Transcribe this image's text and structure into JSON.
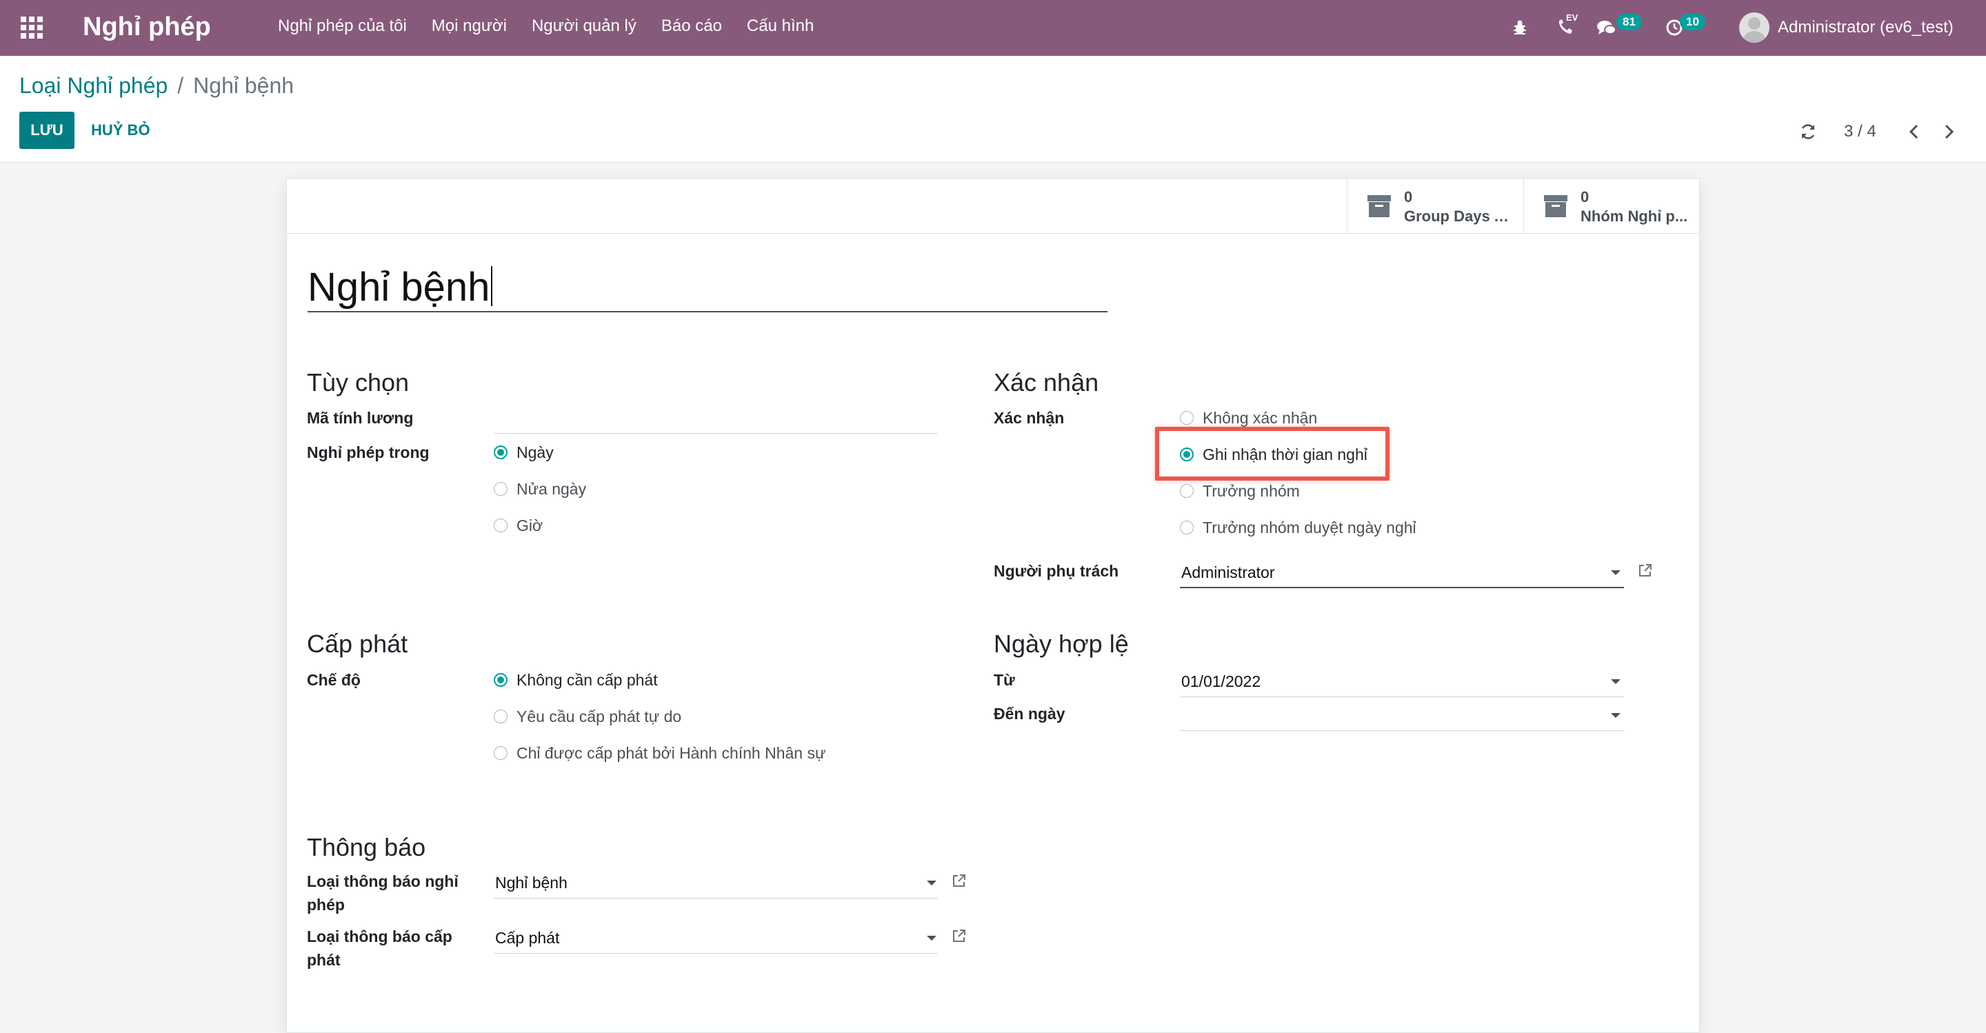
{
  "navbar": {
    "app_name": "Nghỉ phép",
    "menu": [
      "Nghỉ phép của tôi",
      "Mọi người",
      "Người quản lý",
      "Báo cáo",
      "Cấu hình"
    ],
    "messages_count": "81",
    "activities_count": "10",
    "phone_badge": "EV",
    "user": "Administrator (ev6_test)"
  },
  "breadcrumb": {
    "parent": "Loại Nghỉ phép",
    "separator": "/",
    "current": "Nghỉ bệnh"
  },
  "actions": {
    "save": "LƯU",
    "discard": "HUỶ BỎ"
  },
  "pager": {
    "value": "3 / 4"
  },
  "stat_buttons": [
    {
      "value": "0",
      "label": "Group Days A..."
    },
    {
      "value": "0",
      "label": "Nhóm Nghỉ p..."
    }
  ],
  "form": {
    "name": "Nghỉ bệnh",
    "options": {
      "title": "Tùy chọn",
      "payroll_code_label": "Mã tính lương",
      "payroll_code_value": "",
      "request_unit_label": "Nghỉ phép trong",
      "request_unit_options": [
        "Ngày",
        "Nửa ngày",
        "Giờ"
      ],
      "request_unit_selected": 0
    },
    "validation": {
      "title": "Xác nhận",
      "validation_label": "Xác nhận",
      "validation_options": [
        "Không xác nhận",
        "Ghi nhận thời gian nghỉ",
        "Trưởng nhóm",
        "Trưởng nhóm duyệt ngày nghỉ"
      ],
      "validation_selected": 1,
      "responsible_label": "Người phụ trách",
      "responsible_value": "Administrator"
    },
    "allocation": {
      "title": "Cấp phát",
      "mode_label": "Chế độ",
      "mode_options": [
        "Không cần cấp phát",
        "Yêu cầu cấp phát tự do",
        "Chỉ được cấp phát bởi Hành chính Nhân sự"
      ],
      "mode_selected": 0
    },
    "validity": {
      "title": "Ngày hợp lệ",
      "from_label": "Từ",
      "from_value": "01/01/2022",
      "to_label": "Đến ngày",
      "to_value": ""
    },
    "notification": {
      "title": "Thông báo",
      "leave_notif_label": "Loại thông báo nghỉ phép",
      "leave_notif_value": "Nghỉ bệnh",
      "alloc_notif_label": "Loại thông báo cấp phát",
      "alloc_notif_value": "Cấp phát"
    }
  },
  "colors": {
    "navbar": "#875a7b",
    "primary": "#017e84",
    "radio": "#00a09d",
    "highlight": "#f0574a"
  }
}
